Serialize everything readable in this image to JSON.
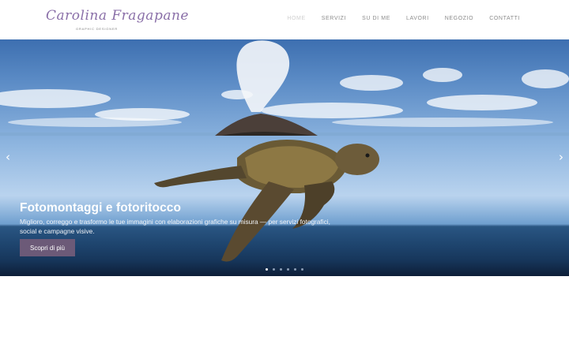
{
  "brand": {
    "name": "Carolina Fragapane",
    "tagline": "GRAPHIC DESIGNER"
  },
  "nav": {
    "items": [
      {
        "label": "HOME"
      },
      {
        "label": "SERVIZI"
      },
      {
        "label": "SU DI ME"
      },
      {
        "label": "LAVORI"
      },
      {
        "label": "NEGOZIO"
      },
      {
        "label": "CONTATTI"
      }
    ],
    "active_index": 0
  },
  "slider": {
    "title": "Fotomontaggi e fotoritocco",
    "text": "Miglioro, correggo e trasformo le tue immagini con elaborazioni grafiche su misura — per servizi fotografici, social e campagne visive.",
    "button_label": "Scopri di più",
    "prev_glyph": "‹",
    "next_glyph": "›",
    "slide_count": 6,
    "active_slide": 1
  },
  "colors": {
    "brand_purple": "#8a6fa8",
    "button": "#6c5a78",
    "nav_text": "#8c8c8c"
  },
  "icons": {
    "prev": "chevron-left-icon",
    "next": "chevron-right-icon"
  }
}
